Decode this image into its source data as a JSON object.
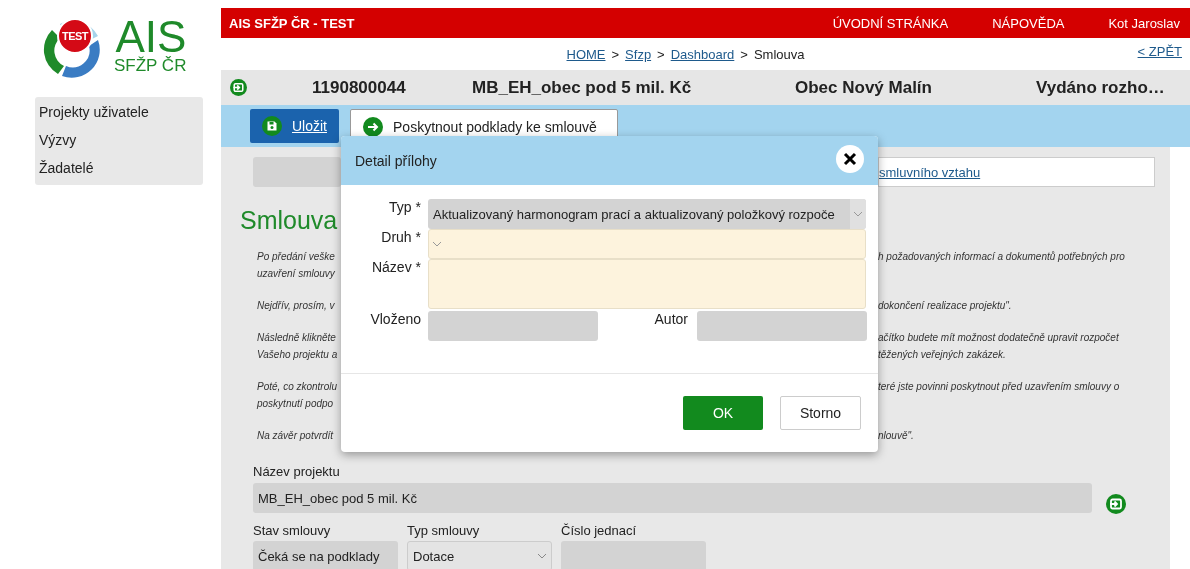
{
  "logo": {
    "badge": "TEST",
    "title": "AIS",
    "subtitle": "SFŽP ČR"
  },
  "sidebar": {
    "items": [
      {
        "label": "Projekty uživatele"
      },
      {
        "label": "Výzvy"
      },
      {
        "label": "Žadatelé"
      }
    ]
  },
  "topbar": {
    "title": "AIS SFŽP ČR - TEST",
    "links": [
      "ÚVODNÍ STRÁNKA",
      "NÁPOVĚDA",
      "Kot Jaroslav"
    ]
  },
  "breadcrumb": {
    "items": [
      {
        "label": "HOME",
        "link": true
      },
      {
        "label": "Sfzp",
        "link": true
      },
      {
        "label": "Dashboard",
        "link": true
      },
      {
        "label": "Smlouva",
        "link": false
      }
    ],
    "separator": ">",
    "back": "< ZPĚT"
  },
  "record_bar": {
    "number": "1190800044",
    "name": "MB_EH_obec pod 5 mil. Kč",
    "applicant": "Obec Nový Malín",
    "status": "Vydáno rozho…"
  },
  "toolbar": {
    "buttons": [
      {
        "label": "Uložit",
        "kind": "primary"
      },
      {
        "label": "Poskytnout podklady ke smlouvě",
        "kind": "secondary"
      }
    ]
  },
  "content": {
    "link_box": "smluvního vztahu",
    "heading": "Smlouva",
    "paragraphs": [
      {
        "lines": [
          {
            "left": "Po předání veške",
            "right": "h požadovaných informací a dokumentů potřebných pro"
          },
          {
            "left": "uzavření smlouvy"
          }
        ]
      },
      {
        "lines": [
          {
            "left": "Nejdřív, prosím, v",
            "right": "dokončení realizace projektu\"."
          }
        ]
      },
      {
        "lines": [
          {
            "left": "Následně klikněte",
            "right": "ačítko budete mít možnost dodatečně upravit rozpočet"
          },
          {
            "left": "Vašeho projektu a",
            "right": "těžených veřejných zakázek."
          }
        ]
      },
      {
        "lines": [
          {
            "left": "Poté, co zkontrolu",
            "right": "teré jste povinni poskytnout před uzavřením smlouvy o"
          },
          {
            "left": "poskytnutí podpo"
          }
        ]
      },
      {
        "lines": [
          {
            "left": "Na závěr potvrdít",
            "right": "nlouvě\"."
          }
        ]
      }
    ],
    "project_name": {
      "label": "Název projektu",
      "value": "MB_EH_obec pod 5 mil. Kč"
    },
    "fields": [
      {
        "label": "Stav smlouvy",
        "value": "Čeká se na podklady",
        "kind": "text"
      },
      {
        "label": "Typ smlouvy",
        "value": "Dotace",
        "kind": "select"
      },
      {
        "label": "Číslo jednací",
        "kind": "text"
      }
    ]
  },
  "dialog": {
    "title": "Detail přílohy",
    "fields": [
      {
        "label": "Typ *",
        "kind": "select",
        "disabled": true,
        "value": "Aktualizovaný harmonogram prací a aktualizovaný položkový rozpoče"
      },
      {
        "label": "Druh *",
        "kind": "select",
        "disabled": false
      },
      {
        "label": "Název *",
        "kind": "textarea",
        "disabled": false
      }
    ],
    "meta_fields": [
      {
        "label": "Vloženo",
        "disabled": true
      },
      {
        "label": "Autor",
        "disabled": true
      }
    ],
    "buttons": [
      {
        "label": "OK",
        "kind": "primary"
      },
      {
        "label": "Storno",
        "kind": "secondary"
      }
    ]
  }
}
